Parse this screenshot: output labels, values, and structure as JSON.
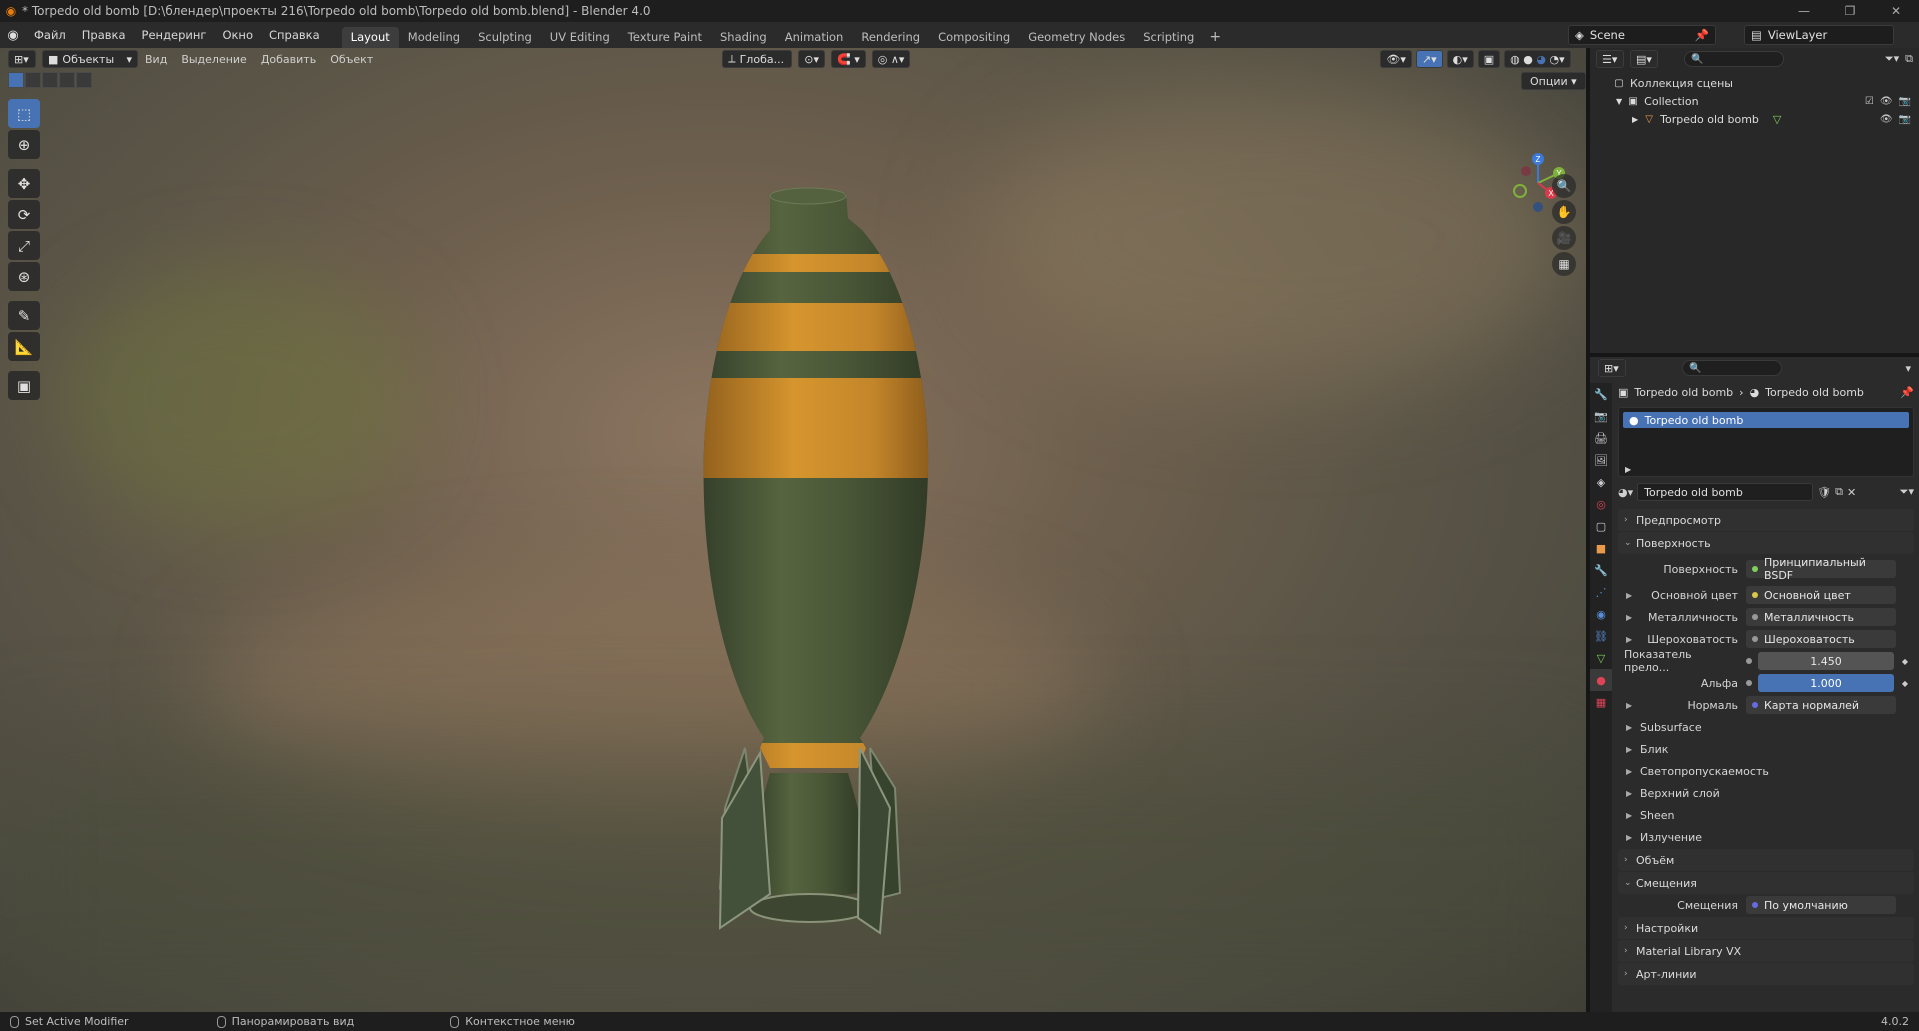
{
  "window": {
    "title": "* Torpedo old bomb [D:\\блендер\\проекты 216\\Torpedo old bomb\\Torpedo old bomb.blend] - Blender 4.0"
  },
  "menu": [
    "Файл",
    "Правка",
    "Рендеринг",
    "Окно",
    "Справка"
  ],
  "workspaces": [
    "Layout",
    "Modeling",
    "Sculpting",
    "UV Editing",
    "Texture Paint",
    "Shading",
    "Animation",
    "Rendering",
    "Compositing",
    "Geometry Nodes",
    "Scripting"
  ],
  "scene": {
    "name": "Scene",
    "view_layer": "ViewLayer"
  },
  "viewport": {
    "mode": "Объекты",
    "menu": [
      "Вид",
      "Выделение",
      "Добавить",
      "Объект"
    ],
    "orientation": "Глоба...",
    "options_label": "Опции",
    "gizmo": {
      "x": "X",
      "y": "Y",
      "z": "Z"
    }
  },
  "outliner": {
    "root": "Коллекция сцены",
    "collection": "Collection",
    "object": "Torpedo old bomb"
  },
  "properties": {
    "breadcrumb": {
      "object": "Torpedo old bomb",
      "material": "Torpedo old bomb"
    },
    "slot": "Torpedo old bomb",
    "material_name": "Torpedo old bomb",
    "panels": {
      "preview": "Предпросмотр",
      "surface": "Поверхность",
      "volume": "Объём",
      "displacement": "Смещения",
      "settings": "Настройки",
      "library": "Material Library VX",
      "lineart": "Арт-линии"
    },
    "surface": {
      "surface_label": "Поверхность",
      "surface_value": "Принципиальный BSDF",
      "base_color_label": "Основной цвет",
      "base_color_value": "Основной цвет",
      "metallic_label": "Металличность",
      "metallic_value": "Металличность",
      "roughness_label": "Шероховатость",
      "roughness_value": "Шероховатость",
      "ior_label": "Показатель прело...",
      "ior_value": "1.450",
      "alpha_label": "Альфа",
      "alpha_value": "1.000",
      "normal_label": "Нормаль",
      "normal_value": "Карта нормалей",
      "subs": [
        "Subsurface",
        "Блик",
        "Светопропускаемость",
        "Верхний слой",
        "Sheen",
        "Излучение"
      ]
    },
    "displacement": {
      "label": "Смещения",
      "value": "По умолчанию"
    }
  },
  "status": {
    "left": "Set Active Modifier",
    "middle": "Панорамировать вид",
    "right": "Контекстное меню",
    "version": "4.0.2"
  },
  "colors": {
    "accent": "#4772b3",
    "stripe": "#d08a2a",
    "body": "#4d5a3a"
  }
}
